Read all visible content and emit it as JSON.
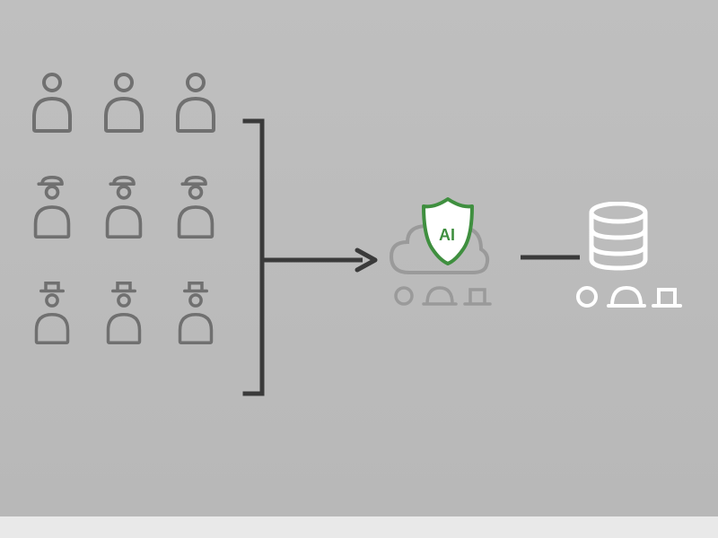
{
  "diagram": {
    "users": {
      "rows": 3,
      "cols": 3,
      "variants": [
        "plain",
        "cap",
        "top-hat"
      ]
    },
    "shield_label": "AI",
    "colors": {
      "stroke_dark": "#4a4a4a",
      "stroke_user": "#707070",
      "stroke_faded": "#9a9a9a",
      "stroke_white": "#ffffff",
      "shield_green": "#3f8f3f",
      "shield_fill": "#ffffff"
    },
    "flow": [
      "users",
      "bracket",
      "arrow",
      "cloud_ai_shield",
      "connector",
      "database"
    ],
    "footer_shapes": [
      "circle",
      "arch",
      "pedestal"
    ]
  }
}
